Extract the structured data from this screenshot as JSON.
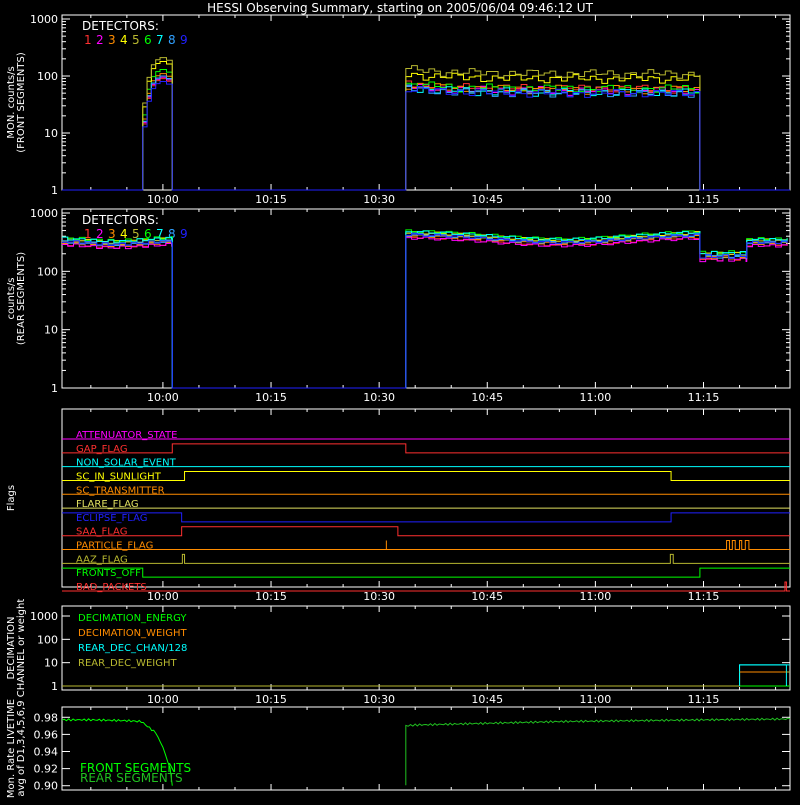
{
  "title": "HESSI Observing Summary, starting on 2005/06/04 09:46:12 UT",
  "time_ticks": [
    "10:00",
    "10:15",
    "10:30",
    "10:45",
    "11:00",
    "11:15"
  ],
  "detector_colors": [
    "#ff3030",
    "#ff00ff",
    "#ff8c00",
    "#ffff00",
    "#b8b830",
    "#00ff00",
    "#00ffff",
    "#30a0ff",
    "#2020ff"
  ],
  "chart_data": [
    {
      "type": "line",
      "panel": "front",
      "ylabel": [
        "MON. counts/s",
        "(FRONT SEGMENTS)"
      ],
      "yscale": "log",
      "ylim": [
        1,
        1000
      ],
      "ytick_labels": [
        "1",
        "10",
        "100",
        "1000"
      ],
      "legend_title": "DETECTORS:",
      "legend_labels": [
        "1",
        "2",
        "3",
        "4",
        "5",
        "6",
        "7",
        "8",
        "9"
      ],
      "x_range_minutes": [
        -14,
        87
      ],
      "series_profile": {
        "description": "counts/s per detector vs time (minutes after 10:00)",
        "x": [
          -14,
          -2.8,
          -2.8,
          -2.0,
          -1.2,
          -0.5,
          0.5,
          1.3,
          1.3,
          33.7,
          33.7,
          40,
          50,
          60,
          70,
          74.5,
          74.5,
          87
        ],
        "detector_levels_at_peak": [
          90,
          95,
          110,
          180,
          210,
          130,
          100,
          100,
          80
        ],
        "detector_levels_second_segment": [
          60,
          55,
          58,
          90,
          110,
          60,
          52,
          50,
          50
        ]
      },
      "series": [
        {
          "name": "1",
          "values": [
            1,
            1,
            15,
            45,
            80,
            95,
            90,
            1,
            1,
            1,
            60,
            58,
            57,
            56,
            58,
            58,
            1,
            1
          ]
        },
        {
          "name": "4",
          "values": [
            1,
            1,
            25,
            70,
            140,
            190,
            170,
            1,
            1,
            1,
            90,
            88,
            86,
            85,
            88,
            88,
            1,
            1
          ]
        },
        {
          "name": "5",
          "values": [
            1,
            1,
            30,
            90,
            160,
            210,
            190,
            1,
            1,
            1,
            115,
            105,
            100,
            98,
            102,
            100,
            1,
            1
          ]
        },
        {
          "name": "9",
          "values": [
            1,
            1,
            18,
            50,
            80,
            90,
            80,
            1,
            1,
            1,
            52,
            48,
            47,
            47,
            48,
            48,
            1,
            1
          ]
        }
      ]
    },
    {
      "type": "line",
      "panel": "rear",
      "ylabel": [
        "counts/s",
        "(REAR SEGMENTS)"
      ],
      "yscale": "log",
      "ylim": [
        1,
        1000
      ],
      "ytick_labels": [
        "1",
        "10",
        "100",
        "1000"
      ],
      "legend_title": "DETECTORS:",
      "legend_labels": [
        "1",
        "2",
        "3",
        "4",
        "5",
        "6",
        "7",
        "8",
        "9"
      ],
      "series": [
        {
          "name": "1",
          "values_x": [
            -14,
            -10,
            -5,
            0,
            1.3,
            1.3,
            33.7,
            33.7,
            40,
            50,
            60,
            70,
            74.5,
            75,
            80,
            82,
            83,
            87
          ],
          "values": [
            300,
            280,
            270,
            290,
            300,
            1,
            1,
            400,
            380,
            340,
            320,
            330,
            340,
            180,
            170,
            250,
            260,
            270
          ]
        },
        {
          "name": "7",
          "values_x": [
            -14,
            -10,
            -5,
            0,
            1.3,
            1.3,
            33.7,
            33.7,
            40,
            50,
            60,
            70,
            74.5,
            75,
            80,
            82,
            83,
            87
          ],
          "values": [
            380,
            350,
            330,
            340,
            360,
            1,
            1,
            500,
            460,
            420,
            400,
            410,
            420,
            210,
            200,
            310,
            320,
            330
          ]
        },
        {
          "name": "9",
          "values_x": [
            -14,
            -10,
            -5,
            0,
            1.3,
            1.3,
            33.7,
            33.7,
            40,
            50,
            60,
            70,
            74.5,
            75,
            80,
            82,
            83,
            87
          ],
          "values": [
            330,
            300,
            290,
            300,
            320,
            1,
            1,
            460,
            420,
            380,
            360,
            370,
            380,
            190,
            180,
            280,
            290,
            300
          ]
        }
      ]
    },
    {
      "type": "line",
      "panel": "flags",
      "ylabel": "Flags",
      "flags": [
        {
          "label": "ATTENUATOR_STATE",
          "color": "#ff00ff",
          "steps": [
            [
              -14,
              0
            ]
          ]
        },
        {
          "label": "GAP_FLAG",
          "color": "#ff3030",
          "steps": [
            [
              -14,
              0
            ],
            [
              1.3,
              1
            ],
            [
              33.7,
              0
            ]
          ]
        },
        {
          "label": "NON_SOLAR_EVENT",
          "color": "#00ffff",
          "steps": [
            [
              -14,
              0
            ]
          ]
        },
        {
          "label": "SC_IN_SUNLIGHT",
          "color": "#ffff00",
          "steps": [
            [
              -14,
              0
            ],
            [
              3.0,
              1
            ],
            [
              70.5,
              0
            ]
          ]
        },
        {
          "label": "SC_TRANSMITTER",
          "color": "#ff8c00",
          "steps": [
            [
              -14,
              0
            ]
          ]
        },
        {
          "label": "FLARE_FLAG",
          "color": "#e0e060",
          "steps": [
            [
              -14,
              0
            ]
          ]
        },
        {
          "label": "ECLIPSE_FLAG",
          "color": "#2020ff",
          "steps": [
            [
              -14,
              1
            ],
            [
              2.6,
              0
            ],
            [
              70.5,
              1
            ]
          ]
        },
        {
          "label": "SAA_FLAG",
          "color": "#ff3030",
          "steps": [
            [
              -14,
              0
            ],
            [
              2.6,
              1
            ],
            [
              32.6,
              0
            ]
          ]
        },
        {
          "label": "PARTICLE_FLAG",
          "color": "#ff8c00",
          "steps": [
            [
              -14,
              0
            ],
            [
              31.0,
              1
            ],
            [
              31.0,
              0
            ],
            [
              78.2,
              1
            ],
            [
              78.6,
              0
            ],
            [
              79.0,
              1
            ],
            [
              79.4,
              0
            ],
            [
              80.0,
              1
            ],
            [
              80.3,
              0
            ],
            [
              80.8,
              1
            ],
            [
              81.3,
              0
            ]
          ]
        },
        {
          "label": "AAZ_FLAG",
          "color": "#b8b830",
          "steps": [
            [
              -14,
              0
            ],
            [
              2.7,
              1
            ],
            [
              3.0,
              0
            ],
            [
              70.4,
              1
            ],
            [
              70.8,
              0
            ]
          ]
        },
        {
          "label": "FRONTS_OFF",
          "color": "#00ff00",
          "steps": [
            [
              -14,
              1
            ],
            [
              -2.8,
              0
            ],
            [
              74.5,
              1
            ]
          ]
        },
        {
          "label": "BAD_PACKETS",
          "color": "#ff3030",
          "steps": [
            [
              -14,
              0
            ],
            [
              86.3,
              1
            ],
            [
              86.5,
              0
            ]
          ]
        }
      ]
    },
    {
      "type": "line",
      "panel": "decimation",
      "ylabel": [
        "DECIMATION",
        "CHANNEL or weight"
      ],
      "yscale": "log",
      "ylim": [
        1,
        1000
      ],
      "ytick_labels": [
        "1",
        "10",
        "100",
        "1000"
      ],
      "series": [
        {
          "name": "DECIMATION_ENERGY",
          "color": "#00ff00",
          "x": [
            -14,
            87
          ],
          "values": [
            1,
            1
          ]
        },
        {
          "name": "DECIMATION_WEIGHT",
          "color": "#ff8c00",
          "x": [
            -14,
            80,
            80,
            87
          ],
          "values": [
            1,
            1,
            4,
            4
          ]
        },
        {
          "name": "REAR_DEC_CHAN/128",
          "color": "#00ffff",
          "x": [
            -14,
            80,
            80,
            87
          ],
          "values": [
            1,
            1,
            8,
            8
          ]
        },
        {
          "name": "REAR_DEC_WEIGHT",
          "color": "#b8b830",
          "x": [
            -14,
            80,
            80,
            87
          ],
          "values": [
            1,
            1,
            4,
            4
          ]
        }
      ]
    },
    {
      "type": "line",
      "panel": "livetime",
      "ylabel": [
        "Mon. Rate LIVETIME",
        "avg of D1,3,4,5,6,9"
      ],
      "ylim": [
        0.9,
        0.98
      ],
      "ytick_labels": [
        "0.90",
        "0.92",
        "0.94",
        "0.96",
        "0.98"
      ],
      "series": [
        {
          "name": "FRONT SEGMENTS",
          "color": "#00ff00",
          "x": [
            -14,
            -10,
            -5,
            -3,
            -1,
            0,
            1,
            1.3
          ],
          "values": [
            0.977,
            0.977,
            0.976,
            0.975,
            0.962,
            0.945,
            0.92,
            0.9
          ]
        },
        {
          "name": "REAR SEGMENTS",
          "color": "#20c020",
          "x": [
            33.7,
            33.7,
            35,
            45,
            55,
            65,
            75,
            87
          ],
          "values": [
            0.9,
            0.97,
            0.971,
            0.973,
            0.975,
            0.976,
            0.977,
            0.978
          ]
        }
      ]
    }
  ]
}
